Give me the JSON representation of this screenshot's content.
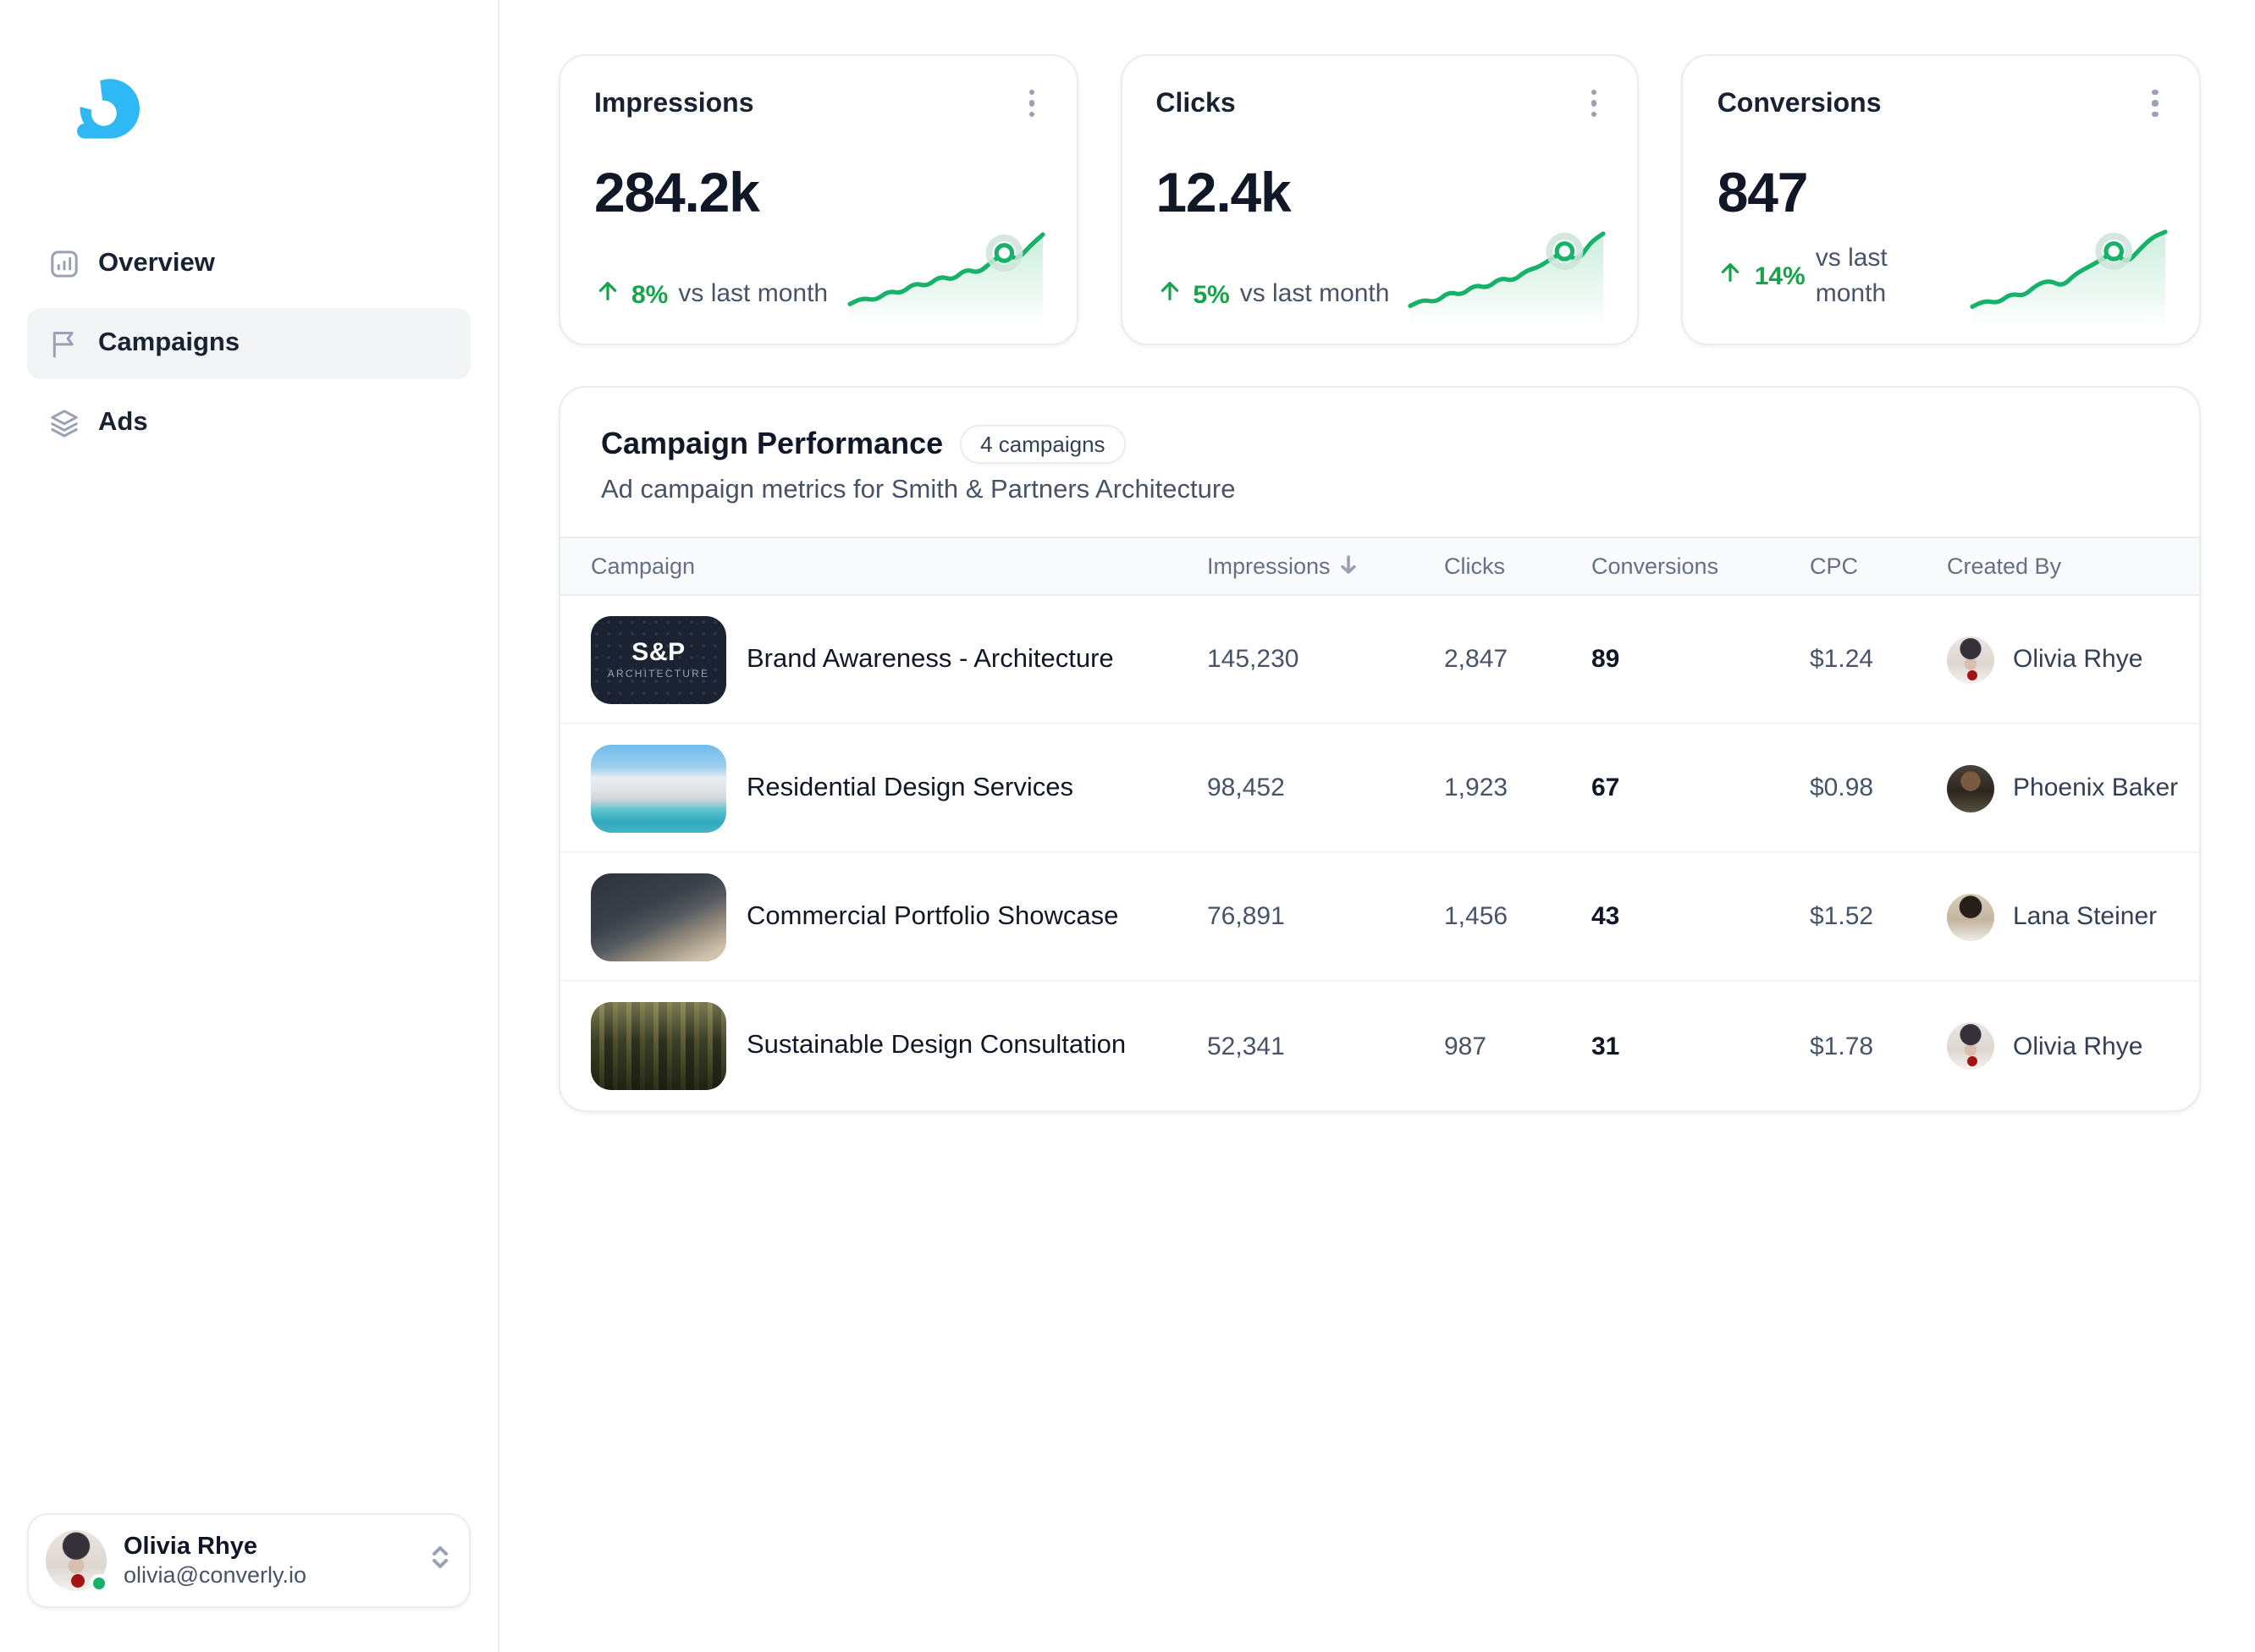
{
  "colors": {
    "logo_blue": "#2EB9F4",
    "accent_green_text": "#16a34a",
    "spark_line_green": "#17B26A",
    "border": "#EAECF0"
  },
  "sidebar": {
    "nav": [
      {
        "label": "Overview",
        "icon": "bar-chart-square-icon",
        "active": false
      },
      {
        "label": "Campaigns",
        "icon": "flag-icon",
        "active": true
      },
      {
        "label": "Ads",
        "icon": "layers-icon",
        "active": false
      }
    ],
    "user": {
      "name": "Olivia Rhye",
      "email": "olivia@converly.io",
      "status": "online"
    }
  },
  "stat_cards": [
    {
      "title": "Impressions",
      "value": "284.2k",
      "change": "8%",
      "change_label": "vs last month",
      "sparkline": [
        0.18,
        0.25,
        0.22,
        0.33,
        0.3,
        0.42,
        0.38,
        0.5,
        0.45,
        0.58,
        0.53,
        0.66,
        0.76,
        0.68,
        0.84,
        0.97
      ],
      "marker_index": 12
    },
    {
      "title": "Clicks",
      "value": "12.4k",
      "change": "5%",
      "change_label": "vs last month",
      "sparkline": [
        0.16,
        0.23,
        0.2,
        0.32,
        0.28,
        0.4,
        0.36,
        0.48,
        0.44,
        0.56,
        0.6,
        0.7,
        0.78,
        0.66,
        0.88,
        0.98
      ],
      "marker_index": 12
    },
    {
      "title": "Conversions",
      "value": "847",
      "change": "14%",
      "change_label": "vs last month",
      "sparkline": [
        0.15,
        0.22,
        0.19,
        0.3,
        0.27,
        0.4,
        0.45,
        0.38,
        0.52,
        0.6,
        0.68,
        0.78,
        0.64,
        0.8,
        0.94,
        1.0
      ],
      "marker_index": 11
    }
  ],
  "panel": {
    "title": "Campaign Performance",
    "badge": "4 campaigns",
    "subtitle": "Ad campaign metrics for Smith & Partners Architecture",
    "columns": [
      "Campaign",
      "Impressions",
      "Clicks",
      "Conversions",
      "CPC",
      "Created By"
    ],
    "sorted_column": "Impressions",
    "rows": [
      {
        "campaign": "Brand Awareness - Architecture",
        "thumb": "sp-architecture-logo",
        "thumb_title": "S&P",
        "thumb_subtitle": "ARCHITECTURE",
        "impressions": "145,230",
        "clicks": "2,847",
        "conversions": "89",
        "cpc": "$1.24",
        "created_by": "Olivia Rhye"
      },
      {
        "campaign": "Residential Design Services",
        "thumb": "modern-house-photo",
        "impressions": "98,452",
        "clicks": "1,923",
        "conversions": "67",
        "cpc": "$0.98",
        "created_by": "Phoenix Baker"
      },
      {
        "campaign": "Commercial Portfolio Showcase",
        "thumb": "interior-gallery-photo",
        "impressions": "76,891",
        "clicks": "1,456",
        "conversions": "43",
        "cpc": "$1.52",
        "created_by": "Lana Steiner"
      },
      {
        "campaign": "Sustainable Design Consultation",
        "thumb": "forest-photo",
        "impressions": "52,341",
        "clicks": "987",
        "conversions": "31",
        "cpc": "$1.78",
        "created_by": "Olivia Rhye"
      }
    ]
  }
}
